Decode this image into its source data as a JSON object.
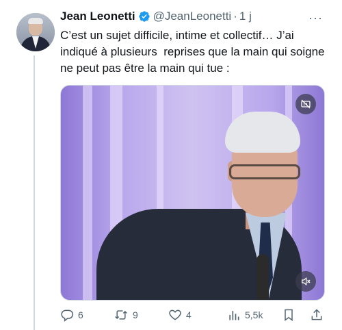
{
  "tweet": {
    "author_name": "Jean Leonetti",
    "handle": "@JeanLeonetti",
    "separator": "·",
    "time": "1 j",
    "more": "···",
    "text": "C’est un sujet difficile, intime et collectif… J’ai indiqué à plusieurs  reprises que la main qui soigne ne peut pas être la main qui tue :"
  },
  "media": {
    "type": "video",
    "muted": true
  },
  "actions": {
    "replies": "6",
    "retweets": "9",
    "likes": "4",
    "views": "5,5k"
  },
  "colors": {
    "verified": "#1d9bf0",
    "secondary_text": "#536471",
    "media_purple": "#b8a7ec"
  },
  "icons": [
    "verified-badge-icon",
    "more-icon",
    "gif-off-icon",
    "mute-icon",
    "reply-icon",
    "retweet-icon",
    "like-icon",
    "views-icon",
    "bookmark-icon",
    "share-icon"
  ]
}
